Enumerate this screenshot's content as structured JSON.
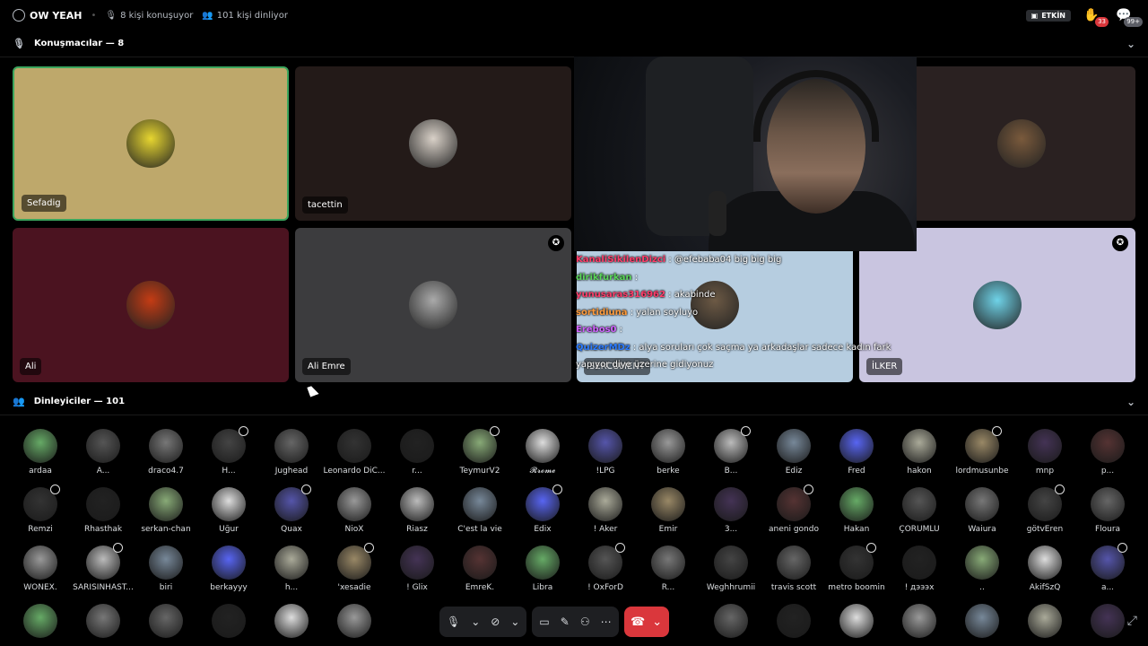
{
  "topbar": {
    "title": "OW YEAH",
    "speaking_count": "8 kişi konuşuyor",
    "listening_count": "101 kişi dinliyor",
    "event_label": "ETKİN",
    "hand_badge": "33",
    "inbox_badge": "99+"
  },
  "speakers_section": {
    "label": "Konuşmacılar — 8"
  },
  "speakers": [
    {
      "name": "Sefadig",
      "bg": "#bea86b",
      "avatar": "#e7d630"
    },
    {
      "name": "tacettin",
      "bg": "#231a18",
      "avatar": "#d9d1c8"
    },
    {
      "name": "Ali",
      "bg": "#4b1320",
      "avatar": "#c43c14"
    },
    {
      "name": "Ali Emre",
      "bg": "#3c3c3e",
      "avatar": "#aaa"
    },
    {
      "name": "SERCUMENT",
      "bg": "#b6cde0",
      "avatar": "#6d5a45"
    },
    {
      "name": "İLKER",
      "bg": "#c9c5e0",
      "avatar": "#6fd3e8"
    },
    {
      "name": "",
      "bg": "#2a2121",
      "avatar": "#7a5a3c"
    }
  ],
  "chat": [
    {
      "user": "KanaliSikilenDizci",
      "color": "#ff3d6a",
      "msg": ": @efebaba04 big big big"
    },
    {
      "user": "dirikfurkan",
      "color": "#5bd65b",
      "msg": ":"
    },
    {
      "user": "yunusaras316962",
      "color": "#ff3d6a",
      "msg": ": akabinde"
    },
    {
      "user": "sortidiuna",
      "color": "#ff9b3b",
      "msg": ": yalan soyluyo"
    },
    {
      "user": "Erebos0",
      "color": "#d064ff",
      "msg": ":"
    },
    {
      "user": "QuizerMDz",
      "color": "#2d7cff",
      "msg": ": alya soruları çok saçma ya arkadaşlar sadece kadın fark"
    },
    {
      "user": "",
      "color": "#fff",
      "msg": "yapıyor diye üzerine gidiyonuz"
    }
  ],
  "listeners_section": {
    "label": "Dinleyiciler — 101"
  },
  "listeners": [
    [
      "ardaa",
      "A...",
      "draco4.7",
      "H...",
      "Jughead",
      "Leonardo DiC...",
      "r...",
      "TeymurV2",
      "𝓡𝓻𝓸𝓶𝓮",
      "!LPG",
      "berke",
      "B...",
      "Ediz",
      "Fred",
      "hakon",
      "lordmusunbe",
      "mnp",
      "p..."
    ],
    [
      "Remzi",
      "Rhasthak",
      "serkan-chan",
      "Uğur",
      "Quax",
      "NioX",
      "Riasz",
      "C'est la vie",
      "Edix",
      "! Aker",
      "Emir",
      "3...",
      "aneni gondo",
      "Hakan",
      "ÇORUMLU",
      "Waiura",
      "götvEren",
      "Floura"
    ],
    [
      "WONEX.",
      "SARISINHAST...",
      "biri",
      "berkayyy",
      "h...",
      "'xesadie",
      "! Glix",
      "EmreK.",
      "Libra",
      "! OxForD",
      "R...",
      "Weghhrumii",
      "travis scott",
      "metro boomin",
      "! дэээх",
      "..",
      "AkifSzQ",
      "a..."
    ]
  ]
}
